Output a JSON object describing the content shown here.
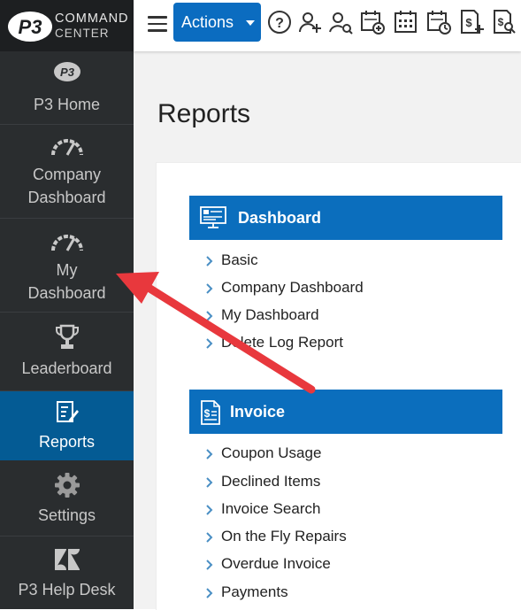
{
  "brand": {
    "badge": "P3",
    "line1": "COMMAND",
    "line2": "CENTER"
  },
  "sidebar": {
    "items": [
      {
        "label": "P3 Home",
        "icon": "p3-logo-icon"
      },
      {
        "label": "Company\nDashboard",
        "icon": "speedometer-icon"
      },
      {
        "label": "My\nDashboard",
        "icon": "speedometer-icon"
      },
      {
        "label": "Leaderboard",
        "icon": "trophy-icon"
      },
      {
        "label": "Reports",
        "icon": "report-icon",
        "active": true
      },
      {
        "label": "Settings",
        "icon": "gear-icon"
      },
      {
        "label": "P3 Help Desk",
        "icon": "zendesk-icon"
      }
    ]
  },
  "toolbar": {
    "actions_label": "Actions",
    "icons": [
      "help-icon",
      "add-user-icon",
      "search-user-icon",
      "add-event-icon",
      "calendar-icon",
      "schedule-icon",
      "add-invoice-icon",
      "search-invoice-icon"
    ]
  },
  "page": {
    "title": "Reports"
  },
  "sections": [
    {
      "title": "Dashboard",
      "icon": "dashboard-icon",
      "links": [
        "Basic",
        "Company Dashboard",
        "My Dashboard",
        "Delete Log Report"
      ]
    },
    {
      "title": "Invoice",
      "icon": "invoice-icon",
      "links": [
        "Coupon Usage",
        "Declined Items",
        "Invoice Search",
        "On the Fly Repairs",
        "Overdue Invoice",
        "Payments"
      ]
    }
  ],
  "colors": {
    "sidebar_bg": "#2a2d2f",
    "active_nav": "#045b94",
    "accent": "#0b6ebd",
    "arrow": "#e8383d"
  }
}
